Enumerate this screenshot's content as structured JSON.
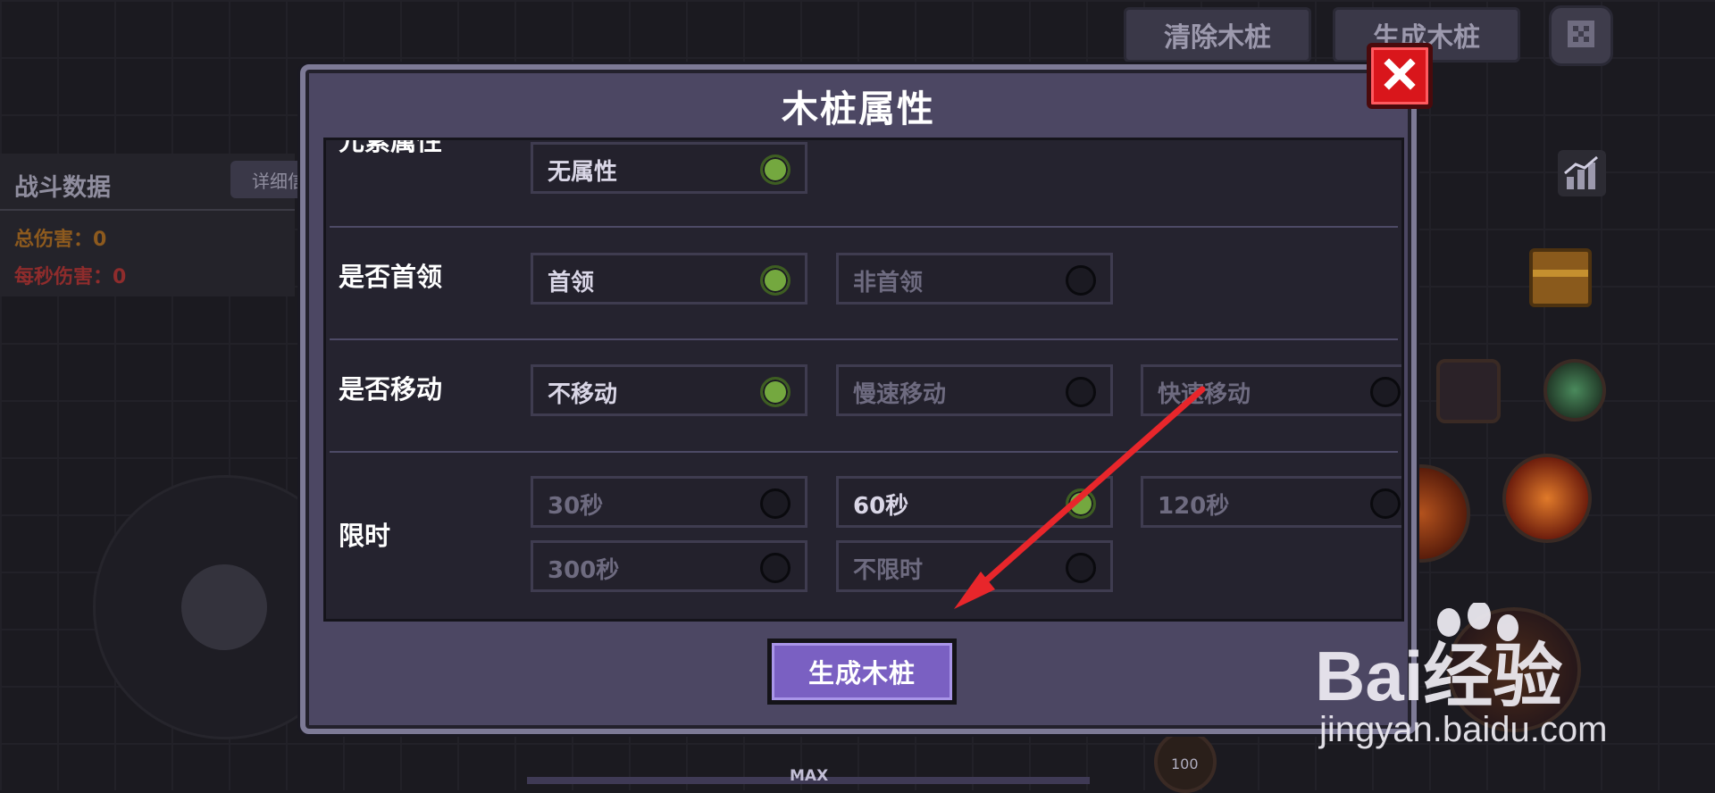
{
  "top_bar": {
    "clear_stake": "清除木桩",
    "generate_stake": "生成木桩"
  },
  "battle": {
    "title": "战斗数据",
    "detail": "详细信",
    "total_damage": "总伤害：0",
    "dps": "每秒伤害：0"
  },
  "hud": {
    "pet_level": "100",
    "max_label": "MAX"
  },
  "modal": {
    "title": "木桩属性",
    "rows": [
      {
        "label": "元素属性",
        "options": [
          {
            "text": "无属性",
            "selected": true
          }
        ]
      },
      {
        "label": "是否首领",
        "options": [
          {
            "text": "首领",
            "selected": true
          },
          {
            "text": "非首领",
            "selected": false
          }
        ]
      },
      {
        "label": "是否移动",
        "options": [
          {
            "text": "不移动",
            "selected": true
          },
          {
            "text": "慢速移动",
            "selected": false
          },
          {
            "text": "快速移动",
            "selected": false
          }
        ]
      },
      {
        "label": "限时",
        "options": [
          {
            "text": "30秒",
            "selected": false
          },
          {
            "text": "60秒",
            "selected": true
          },
          {
            "text": "120秒",
            "selected": false
          },
          {
            "text": "300秒",
            "selected": false
          },
          {
            "text": "不限时",
            "selected": false
          }
        ]
      }
    ],
    "generate_button": "生成木桩"
  },
  "watermark": {
    "brand": "Bai经验",
    "url": "jingyan.baidu.com"
  },
  "colors": {
    "selected_radio": "#74a83f",
    "button_purple": "#7a60c2",
    "close_red": "#d9161b",
    "arrow_red": "#e8262b",
    "total_damage": "#8d5a1e",
    "dps": "#8f2c2c"
  },
  "icons": [
    "settings-icon",
    "close-icon",
    "stats-chart-icon",
    "chest-icon",
    "skill-icon",
    "arrow-annotation"
  ]
}
